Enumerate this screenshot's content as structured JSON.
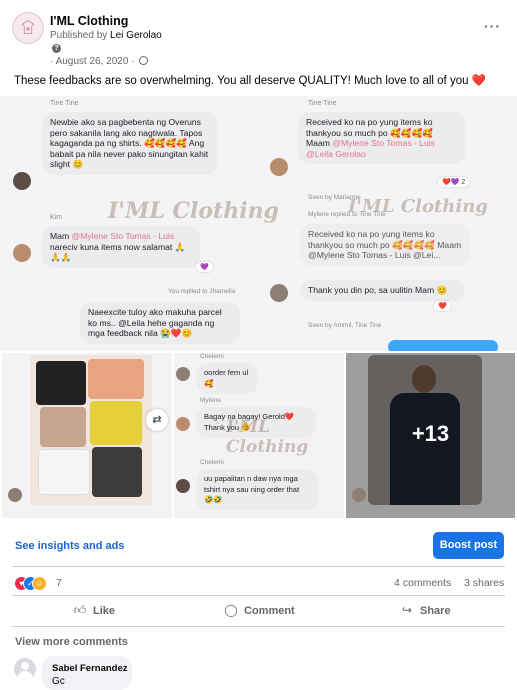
{
  "post": {
    "page_name": "I'ML Clothing",
    "published_by_prefix": "Published by",
    "published_by": "Lei Gerolao",
    "date": "August 26, 2020",
    "date_separator": "·",
    "caption": "These feedbacks are so overwhelming. You all deserve QUALITY! Much love to all of you",
    "caption_emoji": "❤️",
    "more_icon": "more-horizontal-icon"
  },
  "images": {
    "logo_text": "I'ML Clothing",
    "chat": {
      "sender1": "Tine Tine",
      "msg1": "Newbie ako sa pagbebenta ng Overuns pero sakanila lang ako nagtiwala. Tapos kagaganda pa ng shirts. 🥰🥰🥰🥰 Ang babait pa nila never pako sinungitan kahit slight 😊",
      "sender2": "Tine Tine",
      "msg2": "Received ko na po yung items ko thankyou so much po 🥰🥰🥰🥰",
      "msg2_mention_prefix": "Maam ",
      "msg2_mention": "@Mylene Sto Tomas - Luis @Leila Gerolao",
      "msg2_react": "❤️💜 2",
      "sender3": "Kim",
      "msg3_prefix": "Mam ",
      "msg3_mention": "@Mylene Sto Tomas - Luis",
      "msg3_suffix": " nareciv kuna items now salamat 🙏🙏🙏",
      "msg3_react": "💜",
      "msg4": "Naeexcite tuloy ako makuha parcel ko ms.. @Leila hehe gaganda ng mga feedback nila 😭❤️😊",
      "seen_note": "Seen by Marianne",
      "replied_note": "Mylene replied to Tine Tine",
      "msg5": "Received ko na po yung items ko thankyou so much po 🥰🥰🥰🥰 Maam @Mylene Sto Tomas - Luis @Lei...",
      "msg6": "Thank you din po, sa uulitin Mam 😊",
      "seen_note2": "Seen by Ammil, Tine Tine",
      "you_replied": "You replied to Jhamella",
      "msg7": "oorder fem ul 🥰",
      "msg8": "Bagay na bagay! Gerold❤️ Thank you 😊",
      "msg9": "uu papalitan n daw nya mga tshirt nya sau ning order that 🤣🤣",
      "names_small": [
        "Chelemi",
        "Mylene",
        "Chelemi"
      ],
      "plus_more": "+13"
    },
    "watermark": "I'ML Clothing"
  },
  "insights": {
    "link_label": "See insights and ads",
    "boost_label": "Boost post"
  },
  "engagement": {
    "reaction_count": "7",
    "comments": "4 comments",
    "shares": "3 shares",
    "like_label": "Like",
    "comment_label": "Comment",
    "share_label": "Share",
    "reaction_icons": [
      "love-icon",
      "like-icon",
      "care-icon"
    ]
  },
  "comments": {
    "view_more": "View more comments",
    "first": {
      "author": "Sabel Fernandez",
      "text": "Gc"
    }
  },
  "colors": {
    "accent": "#1b74e4",
    "link": "#1b64d1",
    "muted": "#65676b",
    "love": "#f02849"
  }
}
